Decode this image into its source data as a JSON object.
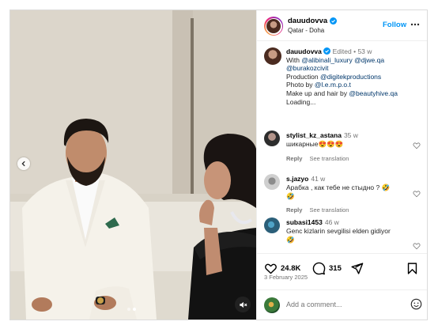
{
  "post": {
    "username": "dauudovva",
    "location": "Qatar - Doha",
    "follow_label": "Follow"
  },
  "caption": {
    "username": "dauudovva",
    "edited": "Edited",
    "separator": " • ",
    "age": "53 w",
    "line1_prefix": "With ",
    "mention1": "@alibinali_luxury",
    "mention2": "@djwe.qa",
    "mention3": "@burakozcivit",
    "line3_prefix": "Production ",
    "mention4": "@digitekproductions",
    "line4_prefix": "Photo by ",
    "mention5": "@l.e.m.p.o.t",
    "line5_prefix": "Make up and hair by ",
    "mention6": "@beautyhive.qa",
    "loading": "Loading..."
  },
  "comments": [
    {
      "username": "stylist_kz_astana",
      "age": "35 w",
      "text": "шикарные😍😍😍",
      "reply": "Reply",
      "translate": "See translation"
    },
    {
      "username": "s.jazyo",
      "age": "41 w",
      "text": "Арабка , как тебе не стыдно ? 🤣",
      "extra": "🤣",
      "reply": "Reply",
      "translate": "See translation"
    },
    {
      "username": "subasi1453",
      "age": "46 w",
      "text": "Genc kizlarin sevgilisi elden gidiyor",
      "extra": "🤣",
      "reply": "",
      "translate": ""
    }
  ],
  "actions": {
    "likes": "24.8K",
    "comments": "315",
    "date": "3 February 2025"
  },
  "add_comment": {
    "placeholder": "Add a comment..."
  },
  "media": {
    "carousel_index": 1,
    "carousel_total": 2
  },
  "colors": {
    "accent": "#0095f6",
    "link": "#00376b",
    "muted": "#737373",
    "border": "#dbdbdb"
  },
  "icons": [
    "chevron-left-icon",
    "mute-icon",
    "verified-icon",
    "more-icon",
    "heart-icon",
    "comment-icon",
    "share-icon",
    "bookmark-icon",
    "emoji-icon"
  ]
}
